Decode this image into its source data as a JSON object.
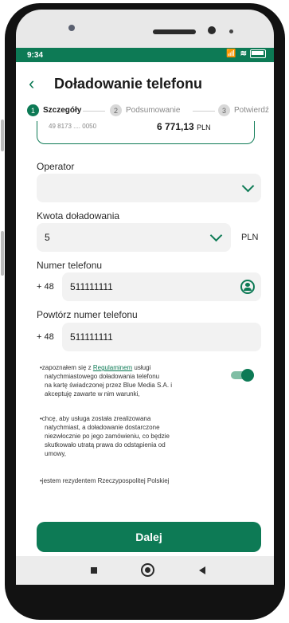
{
  "status_bar": {
    "time": "9:34",
    "icons": "📶 ≋"
  },
  "header": {
    "title": "Doładowanie telefonu"
  },
  "steps": [
    {
      "num": "1",
      "label": "Szczegóły",
      "active": true
    },
    {
      "num": "2",
      "label": "Podsumowanie",
      "active": false
    },
    {
      "num": "3",
      "label": "Potwierdź",
      "active": false
    }
  ],
  "account": {
    "number": "49 8173 .... 0050",
    "balance": "6 771,13",
    "currency": "PLN"
  },
  "operator": {
    "label": "Operator",
    "value": ""
  },
  "amount": {
    "label": "Kwota doładowania",
    "value": "5",
    "unit": "PLN"
  },
  "phone": {
    "label": "Numer telefonu",
    "prefix": "+ 48",
    "value": "511111111"
  },
  "phone_repeat": {
    "label": "Powtórz numer telefonu",
    "prefix": "+ 48",
    "value": "511111111"
  },
  "consent": {
    "p1_before": "•zapoznałem się z ",
    "p1_link": "Regulaminem",
    "p1_after": " usługi",
    "p1_l2": "natychmiastowego doładowania telefonu",
    "p1_l3": "na kartę świadczonej przez Blue Media S.A. i",
    "p1_l4": "akceptuję zawarte w nim warunki,",
    "p2_l1": "•chcę, aby usługa została zrealizowana",
    "p2_l2": "natychmiast, a doładowanie dostarczone",
    "p2_l3": "niezwłocznie po jego zamówieniu, co będzie",
    "p2_l4": "skutkowało utratą prawa do odstąpienia od",
    "p2_l5": "umowy,",
    "p3": "•jestem rezydentem Rzeczypospolitej Polskiej",
    "toggle_on": true
  },
  "button": {
    "label": "Dalej"
  },
  "colors": {
    "accent": "#0d7a55"
  }
}
